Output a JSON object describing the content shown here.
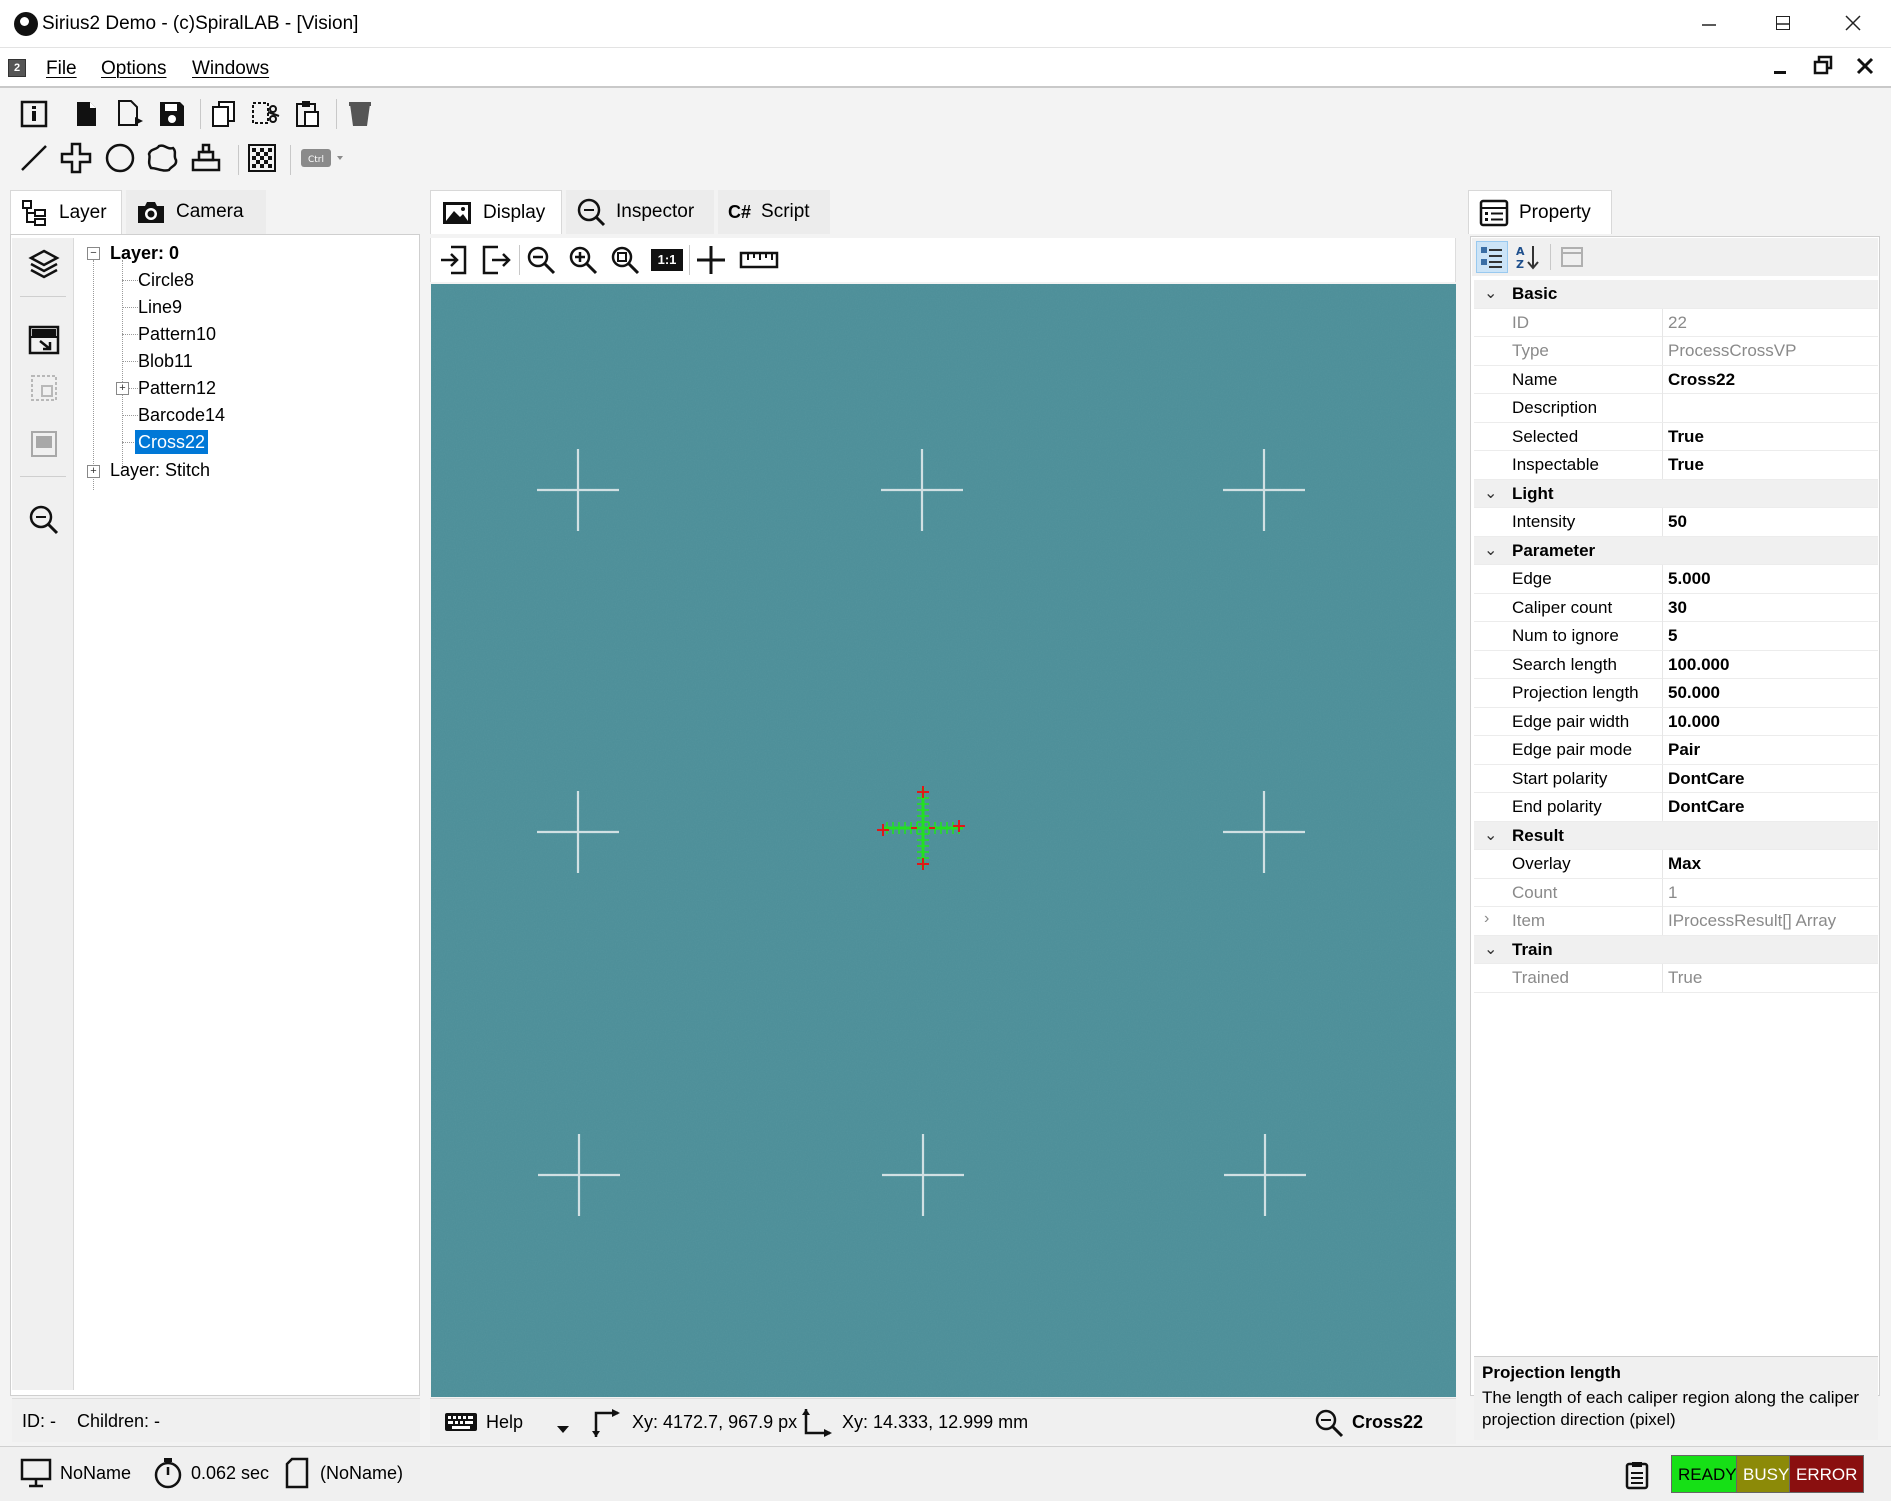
{
  "window": {
    "title": "Sirius2 Demo - (c)SpiralLAB - [Vision]"
  },
  "menu": {
    "items": [
      "File",
      "Options",
      "Windows"
    ]
  },
  "left_tabs": [
    {
      "label": "Layer"
    },
    {
      "label": "Camera"
    }
  ],
  "tree": {
    "root": "Layer: 0",
    "children": [
      "Circle8",
      "Line9",
      "Pattern10",
      "Blob11",
      "Pattern12",
      "Barcode14",
      "Cross22"
    ],
    "selected": "Cross22",
    "second_root": "Layer: Stitch"
  },
  "left_status": {
    "id": "ID: -",
    "children": "Children: -"
  },
  "center_tabs": [
    {
      "label": "Display"
    },
    {
      "label": "Inspector"
    },
    {
      "label": "Script"
    }
  ],
  "center_toolbar": {
    "one_to_one": "1:1"
  },
  "center_status": {
    "help": "Help",
    "xy_px": "Xy: 4172.7, 967.9 px",
    "xy_mm": "Xy: 14.333, 12.999 mm",
    "selected_name": "Cross22"
  },
  "right_tabs": [
    {
      "label": "Property"
    }
  ],
  "properties": {
    "basic": {
      "title": "Basic",
      "id_label": "ID",
      "id_value": "22",
      "type_label": "Type",
      "type_value": "ProcessCrossVP",
      "name_label": "Name",
      "name_value": "Cross22",
      "description_label": "Description",
      "description_value": "",
      "selected_label": "Selected",
      "selected_value": "True",
      "inspectable_label": "Inspectable",
      "inspectable_value": "True"
    },
    "light": {
      "title": "Light",
      "intensity_label": "Intensity",
      "intensity_value": "50"
    },
    "parameter": {
      "title": "Parameter",
      "edge_label": "Edge",
      "edge_value": "5.000",
      "caliper_count_label": "Caliper count",
      "caliper_count_value": "30",
      "num_to_ignore_label": "Num to ignore",
      "num_to_ignore_value": "5",
      "search_length_label": "Search length",
      "search_length_value": "100.000",
      "projection_length_label": "Projection length",
      "projection_length_value": "50.000",
      "edge_pair_width_label": "Edge pair width",
      "edge_pair_width_value": "10.000",
      "edge_pair_mode_label": "Edge pair mode",
      "edge_pair_mode_value": "Pair",
      "start_polarity_label": "Start polarity",
      "start_polarity_value": "DontCare",
      "end_polarity_label": "End polarity",
      "end_polarity_value": "DontCare"
    },
    "result": {
      "title": "Result",
      "overlay_label": "Overlay",
      "overlay_value": "Max",
      "count_label": "Count",
      "count_value": "1",
      "item_label": "Item",
      "item_value": "IProcessResult[] Array"
    },
    "train": {
      "title": "Train",
      "trained_label": "Trained",
      "trained_value": "True"
    }
  },
  "help_box": {
    "title": "Projection length",
    "description": "The length of each caliper region along the caliper projection direction (pixel)"
  },
  "bottom_status": {
    "device": "NoName",
    "time": "0.062 sec",
    "document": "(NoName)",
    "ready": "READY",
    "busy": "BUSY",
    "error": "ERROR"
  },
  "colors": {
    "image_bg": "#4b8d97",
    "selection": "#0078d7",
    "ready": "#16e016",
    "busy": "#8c8a08",
    "error": "#8a0f0f",
    "cross_result": "#22e022",
    "cross_marker": "#e01818"
  },
  "icons": {
    "toolbar_row1": [
      "info-icon",
      "new-file-icon",
      "new-doc-icon",
      "save-icon",
      "copy-icon",
      "cut-icon",
      "paste-icon",
      "delete-icon"
    ],
    "toolbar_row2": [
      "line-tool-icon",
      "cross-tool-icon",
      "circle-tool-icon",
      "blob-tool-icon",
      "pattern-tool-icon",
      "barcode-tool-icon",
      "ctrl-dropdown-icon"
    ]
  }
}
